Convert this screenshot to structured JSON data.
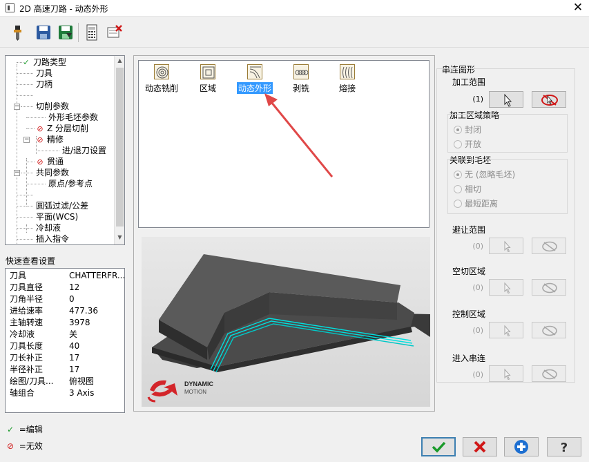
{
  "window": {
    "title": "2D 高速刀路 - 动态外形",
    "close_glyph": "✕",
    "app_icon": "window-icon"
  },
  "toolbar": {
    "buttons": [
      {
        "name": "tool-icon"
      },
      {
        "name": "save-icon"
      },
      {
        "name": "save-as-icon"
      },
      {
        "name": "calculator-icon"
      },
      {
        "name": "delete-operation-icon"
      }
    ]
  },
  "tree": {
    "items": [
      {
        "label": "刀路类型",
        "status": "ok"
      },
      {
        "label": "刀具",
        "status": ""
      },
      {
        "label": "刀柄",
        "status": ""
      },
      {
        "label": "",
        "status": ""
      },
      {
        "label": "切削参数",
        "status": ""
      },
      {
        "label": "外形毛坯参数",
        "status": ""
      },
      {
        "label": "Z 分层切削",
        "status": "disabled"
      },
      {
        "label": "精修",
        "status": "disabled"
      },
      {
        "label": "进/退刀设置",
        "status": ""
      },
      {
        "label": "贯通",
        "status": "disabled"
      },
      {
        "label": "共同参数",
        "status": ""
      },
      {
        "label": "原点/参考点",
        "status": ""
      },
      {
        "label": "",
        "status": ""
      },
      {
        "label": "圆弧过滤/公差",
        "status": ""
      },
      {
        "label": "平面(WCS)",
        "status": ""
      },
      {
        "label": "冷却液",
        "status": ""
      },
      {
        "label": "插入指令",
        "status": ""
      }
    ]
  },
  "quick_view": {
    "label": "快速查看设置",
    "rows": [
      {
        "k": "刀具",
        "v": "CHATTERFR..."
      },
      {
        "k": "刀具直径",
        "v": "12"
      },
      {
        "k": "刀角半径",
        "v": "0"
      },
      {
        "k": "进给速率",
        "v": "477.36"
      },
      {
        "k": "主轴转速",
        "v": "3978"
      },
      {
        "k": "冷却液",
        "v": "关"
      },
      {
        "k": "刀具长度",
        "v": "40"
      },
      {
        "k": "刀长补正",
        "v": "17"
      },
      {
        "k": "半径补正",
        "v": "17"
      },
      {
        "k": "绘图/刀具...",
        "v": "俯视图"
      },
      {
        "k": "轴组合",
        "v": "3 Axis"
      }
    ]
  },
  "legend": {
    "edit": "=编辑",
    "invalid": "=无效"
  },
  "toolpath_types": [
    {
      "label": "动态铣削",
      "icon": "dynamic-mill-icon",
      "selected": false
    },
    {
      "label": "区域",
      "icon": "area-icon",
      "selected": false
    },
    {
      "label": "动态外形",
      "icon": "dynamic-contour-icon",
      "selected": true
    },
    {
      "label": "剥铣",
      "icon": "peel-mill-icon",
      "selected": false
    },
    {
      "label": "熔接",
      "icon": "blend-icon",
      "selected": false
    }
  ],
  "preview": {
    "logo_line1": "DYNAMIC",
    "logo_line2": "MOTION",
    "accent_color": "#00e0e0"
  },
  "chain": {
    "title": "串连图形",
    "machining_range": {
      "label": "加工范围",
      "count": "(1)"
    },
    "strategy": {
      "label": "加工区域策略",
      "options": [
        "封闭",
        "开放"
      ],
      "selected": "封闭"
    },
    "stock": {
      "label": "关联到毛坯",
      "options": [
        "无 (忽略毛坯)",
        "相切",
        "最短距离"
      ],
      "selected": "无 (忽略毛坯)"
    },
    "groups": [
      {
        "label": "避让范围",
        "count": "(0)"
      },
      {
        "label": "空切区域",
        "count": "(0)"
      },
      {
        "label": "控制区域",
        "count": "(0)"
      },
      {
        "label": "进入串连",
        "count": "(0)"
      }
    ]
  },
  "buttons": {
    "ok": "ok-icon",
    "cancel": "cancel-icon",
    "add": "add-icon",
    "help": "help-icon"
  }
}
